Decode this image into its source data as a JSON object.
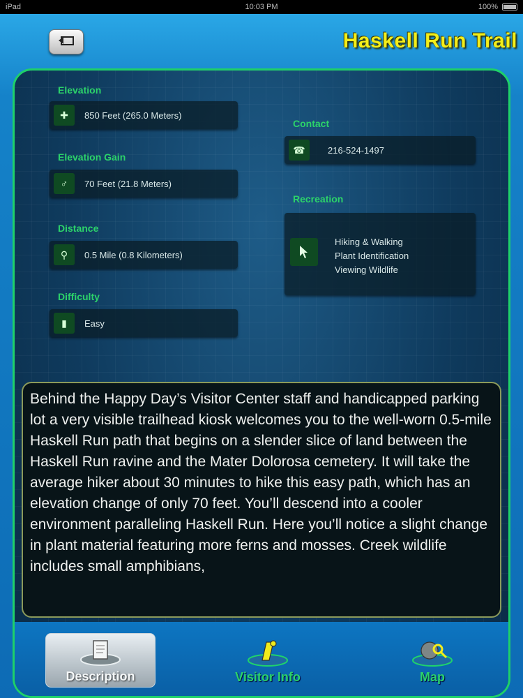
{
  "status": {
    "device": "iPad",
    "time": "10:03 PM",
    "battery": "100%"
  },
  "header": {
    "title": "Haskell Run Trail"
  },
  "left_fields": [
    {
      "label": "Elevation",
      "value": "850 Feet (265.0 Meters)",
      "icon": "plus-icon"
    },
    {
      "label": "Elevation Gain",
      "value": "70 Feet (21.8 Meters)",
      "icon": "mountain-icon"
    },
    {
      "label": "Distance",
      "value": "0.5 Mile (0.8 Kilometers)",
      "icon": "pin-icon"
    },
    {
      "label": "Difficulty",
      "value": "Easy",
      "icon": "level-icon"
    }
  ],
  "contact": {
    "label": "Contact",
    "value": "216-524-1497"
  },
  "recreation": {
    "label": "Recreation",
    "items": [
      "Hiking & Walking",
      "Plant Identification",
      "Viewing Wildlife"
    ]
  },
  "description": "Behind the Happy Day’s Visitor Center staff and handicapped parking lot a very visible trailhead kiosk welcomes you to the well-worn 0.5-mile Haskell Run path that begins on a slender slice of land between the Haskell Run ravine and the Mater Dolorosa cemetery. It will take the average hiker about 30 minutes to hike this easy path, which has an elevation change of only 70 feet. You’ll descend into a cooler environment paralleling Haskell Run. Here you’ll notice a slight change in plant material featuring more ferns and mosses. Creek wildlife includes small amphibians,",
  "tabs": [
    {
      "label": "Description",
      "active": true
    },
    {
      "label": "Visitor Info",
      "active": false
    },
    {
      "label": "Map",
      "active": false
    }
  ],
  "colors": {
    "accent": "#2cd36a",
    "title": "#f3ee1a",
    "panel_border": "#1ed06a"
  }
}
